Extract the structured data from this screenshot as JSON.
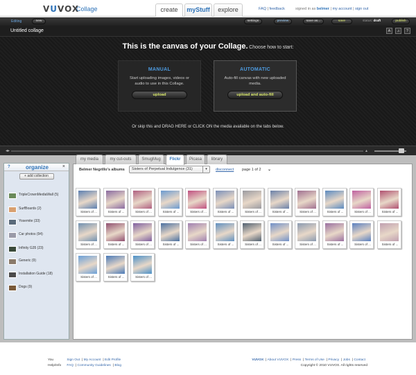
{
  "header": {
    "logo": "VUVOX",
    "logo_sub": "Collage",
    "tabs": [
      "create",
      "myStuff",
      "explore"
    ],
    "faq": "FAQ",
    "feedback": "feedback",
    "signed_in_as": "signed in as",
    "username": "belmer",
    "my_account": "my account",
    "sign_out": "sign out"
  },
  "editbar": {
    "editing": "Editing",
    "new": "new",
    "settings": "settings",
    "preview": "preview",
    "save_as": "save as...",
    "save": "save",
    "status_label": "status:",
    "status_value": "draft",
    "publish": "publish"
  },
  "titlebar": {
    "title": "Untitled collage",
    "icons": [
      "text-icon",
      "music-icon",
      "help-icon"
    ]
  },
  "canvas": {
    "heading": "This is the canvas of your Collage.",
    "subheading": "Choose how to start:",
    "manual": {
      "title": "MANUAL",
      "text": "Start uploading images, videos or audio to use in this Collage.",
      "button": "upload"
    },
    "auto": {
      "title": "AUTOMATIC",
      "text": "Auto-fill canvas with new uploaded media.",
      "button": "upload and auto-fill"
    },
    "hint": "Or skip this and DRAG HERE or CLICK ON the media available on the tabs below."
  },
  "organize": {
    "title": "organize",
    "help": "?",
    "close": "×",
    "add_collection": "+ add collection",
    "collections": [
      {
        "name": "TripleCrownMediaWall (5)",
        "color": "#6a8a5a"
      },
      {
        "name": "SurfBoards (2)",
        "color": "#d8a070"
      },
      {
        "name": "Yosemite (33)",
        "color": "#5a6a7a"
      },
      {
        "name": "Car photos (94)",
        "color": "#9a9aa8"
      },
      {
        "name": "Infinity G35 (23)",
        "color": "#3a4a3a"
      },
      {
        "name": "Generic (9)",
        "color": "#8a7a6a"
      },
      {
        "name": "Installation Guide (18)",
        "color": "#4a4a4a"
      },
      {
        "name": "Dogs (9)",
        "color": "#7a5a3a"
      }
    ]
  },
  "media": {
    "tabs": [
      "my media",
      "my cut-outs",
      "SmugMug",
      "Flickr",
      "Picasa",
      "library"
    ],
    "active_tab": "Flickr",
    "albums_label": "Belmer Negrillo's albums",
    "album_selected": "Sisters of Perpetual Indulgence (31)",
    "disconnect": "disconnect",
    "pager": "page 1 of 2",
    "next_icon": "chevron-down-icon",
    "thumb_caption": "Sisters of ...",
    "thumb_colors": [
      "#5b7fb0",
      "#8a6aa0",
      "#b06080",
      "#6a9ad0",
      "#c05080",
      "#7a8fb8",
      "#9a9aa0",
      "#6a80a8",
      "#a07090",
      "#5a8ac0",
      "#c060a0",
      "#b05070",
      "#7090b0",
      "#905070",
      "#8060a0",
      "#4a70a0",
      "#a080b0",
      "#6090c0",
      "#506070",
      "#7090c8",
      "#8a9ab0",
      "#9a70a0",
      "#5a80c0",
      "#c0a0b0",
      "#6aa0d8",
      "#4a7ab8",
      "#4a90c8"
    ]
  },
  "footer": {
    "you_label": "You",
    "you_links": [
      "Sign Out",
      "My Account",
      "Edit Profile"
    ],
    "help_label": "Help/Info",
    "help_links": [
      "FAQ",
      "Community Guidelines",
      "Blog"
    ],
    "site_links": [
      "VUVOX",
      "About VUVOX",
      "Press",
      "Terms of Use",
      "Privacy",
      "Jobs",
      "Contact"
    ],
    "copyright": "Copyright © 2010 VUVOX. All rights reserved"
  }
}
